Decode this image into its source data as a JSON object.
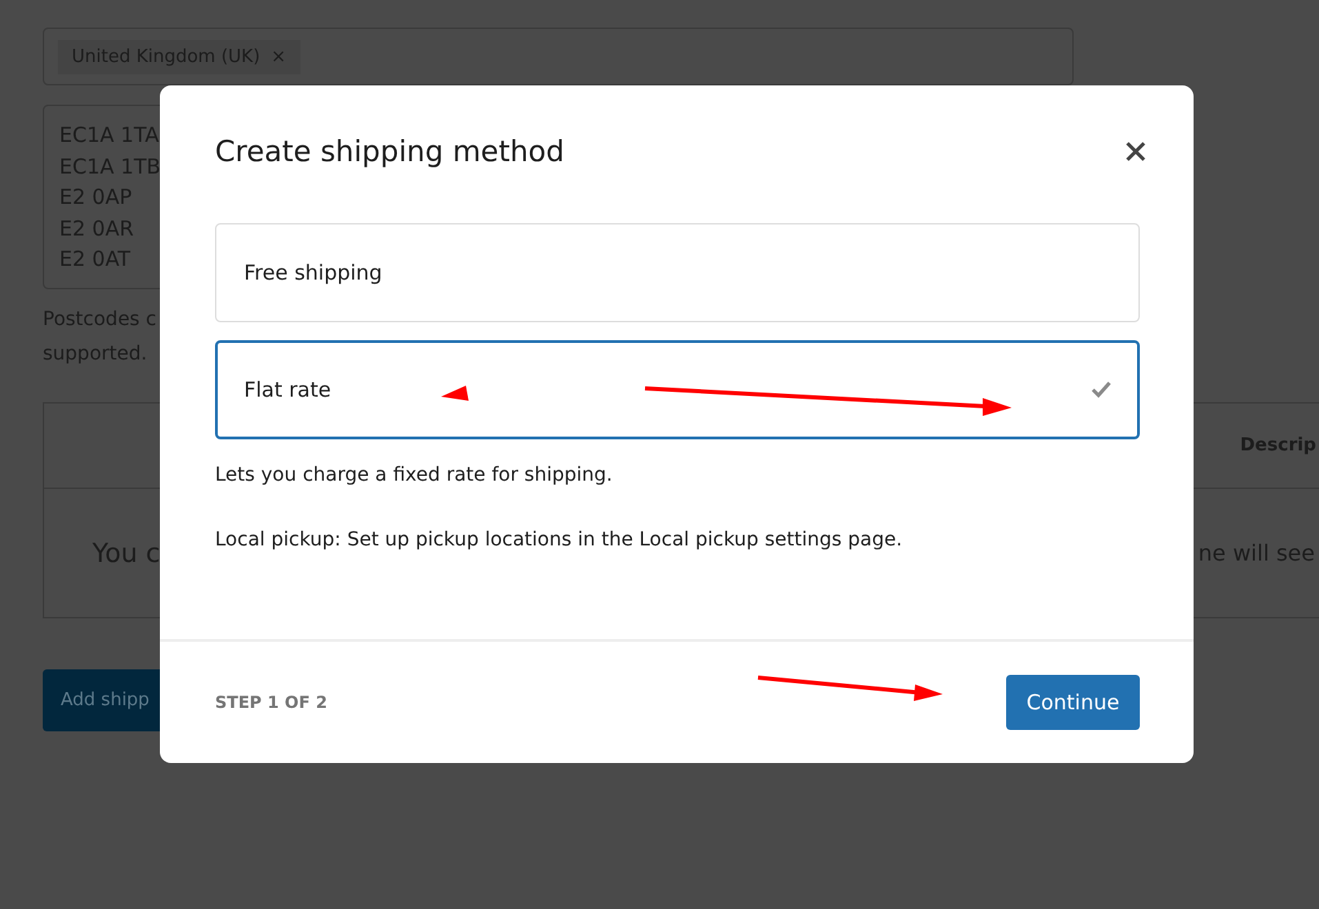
{
  "background": {
    "region_tag": {
      "label": "United Kingdom (UK)",
      "remove": "×"
    },
    "postcodes": [
      "EC1A 1TA",
      "EC1A 1TB",
      "E2 0AP",
      "E2 0AR",
      "E2 0AT"
    ],
    "help_lines": [
      "Postcodes c",
      "supported."
    ],
    "table": {
      "header": "Descrip",
      "empty_left": "You c",
      "empty_right": "ne will see"
    },
    "add_button": "Add shipp"
  },
  "modal": {
    "title": "Create shipping method",
    "options": [
      {
        "label": "Free shipping",
        "selected": false
      },
      {
        "label": "Flat rate",
        "selected": true
      }
    ],
    "description": "Lets you charge a fixed rate for shipping.",
    "note": "Local pickup: Set up pickup locations in the Local pickup settings page.",
    "step": "STEP 1 OF 2",
    "continue": "Continue"
  }
}
